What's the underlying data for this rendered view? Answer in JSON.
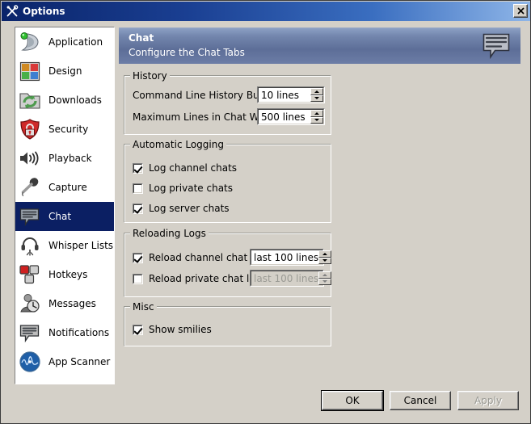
{
  "window": {
    "title": "Options",
    "title_icon": "tools-icon",
    "close_label": "✕",
    "bg_color": "#d4d0c8",
    "titlebar_color": "#0a246a"
  },
  "sidebar": {
    "items": [
      {
        "label": "Application",
        "icon": "application-icon",
        "selected": false
      },
      {
        "label": "Design",
        "icon": "design-icon",
        "selected": false
      },
      {
        "label": "Downloads",
        "icon": "downloads-icon",
        "selected": false
      },
      {
        "label": "Security",
        "icon": "security-icon",
        "selected": false
      },
      {
        "label": "Playback",
        "icon": "playback-icon",
        "selected": false
      },
      {
        "label": "Capture",
        "icon": "capture-icon",
        "selected": false
      },
      {
        "label": "Chat",
        "icon": "chat-icon",
        "selected": true
      },
      {
        "label": "Whisper Lists",
        "icon": "whisper-lists-icon",
        "selected": false
      },
      {
        "label": "Hotkeys",
        "icon": "hotkeys-icon",
        "selected": false
      },
      {
        "label": "Messages",
        "icon": "messages-icon",
        "selected": false
      },
      {
        "label": "Notifications",
        "icon": "notifications-icon",
        "selected": false
      },
      {
        "label": "App Scanner",
        "icon": "app-scanner-icon",
        "selected": false
      }
    ]
  },
  "banner": {
    "title": "Chat",
    "subtitle": "Configure the Chat Tabs",
    "icon": "chat-bubble-icon",
    "accent_color": "#6c7da6"
  },
  "history": {
    "legend": "History",
    "command_line_label": "Command Line History Buffer:",
    "command_line_value": "10 lines",
    "max_lines_label": "Maximum Lines in Chat Window:",
    "max_lines_value": "500 lines"
  },
  "automatic_logging": {
    "legend": "Automatic Logging",
    "items": [
      {
        "label": "Log channel chats",
        "checked": true
      },
      {
        "label": "Log private chats",
        "checked": false
      },
      {
        "label": "Log server chats",
        "checked": true
      }
    ]
  },
  "reloading_logs": {
    "legend": "Reloading Logs",
    "items": [
      {
        "label": "Reload channel chat logs",
        "checked": true,
        "value": "last 100 lines",
        "disabled": false
      },
      {
        "label": "Reload private chat logs",
        "checked": false,
        "value": "last 100 lines",
        "disabled": true
      }
    ]
  },
  "misc": {
    "legend": "Misc",
    "items": [
      {
        "label": "Show smilies",
        "checked": true
      }
    ]
  },
  "buttons": {
    "ok": "OK",
    "cancel": "Cancel",
    "apply": "Apply",
    "apply_disabled": true
  }
}
